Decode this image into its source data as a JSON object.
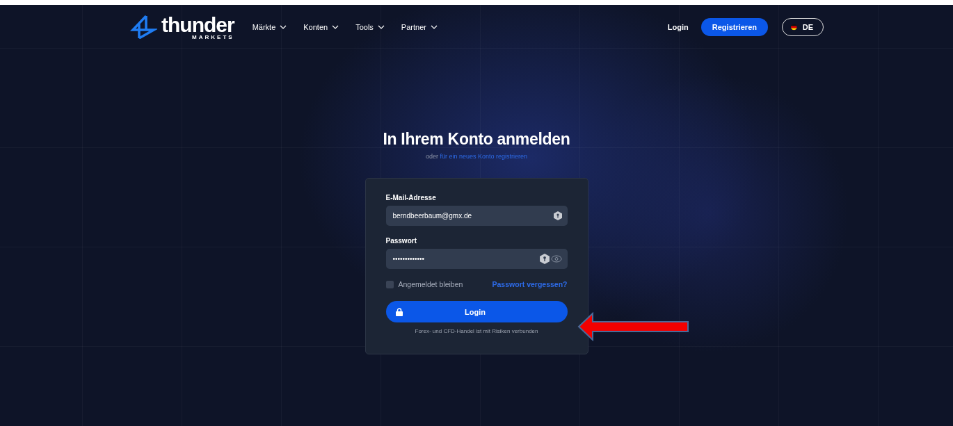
{
  "header": {
    "logo": {
      "name": "thunder",
      "sub": "MARKETS"
    },
    "nav": [
      {
        "label": "Märkte",
        "expanded": false
      },
      {
        "label": "Konten",
        "expanded": false
      },
      {
        "label": "Tools",
        "expanded": false
      },
      {
        "label": "Partner",
        "expanded": false
      }
    ],
    "login": "Login",
    "register": "Registrieren",
    "language": "DE"
  },
  "title": "In Ihrem Konto anmelden",
  "subtitle": {
    "prefix": "oder",
    "link": "für ein neues Konto registrieren"
  },
  "form": {
    "email": {
      "label": "E-Mail-Adresse",
      "value": "berndbeerbaum@gmx.de"
    },
    "password": {
      "label": "Passwort",
      "value": "•••••••••••••"
    },
    "remember": {
      "label": "Angemeldet bleiben",
      "checked": false
    },
    "forgot": "Passwort vergessen?",
    "submit": "Login",
    "disclaimer": "Forex- und CFD-Handel ist mit Risiken verbunden"
  },
  "annotation": {
    "kind": "arrow"
  }
}
